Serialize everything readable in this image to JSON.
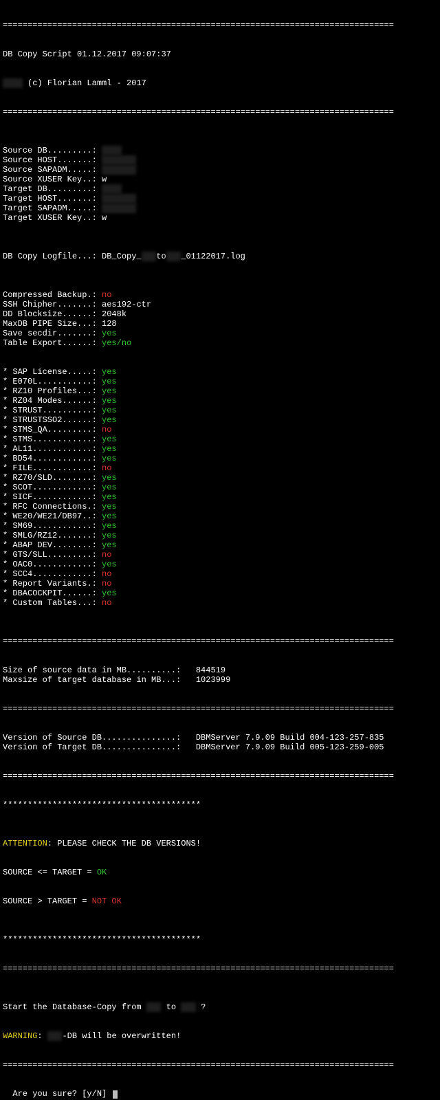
{
  "divider_eq": "===============================================================================",
  "divider_star": "****************************************",
  "header": {
    "title": "DB Copy Script 01.12.2017 09:07:37",
    "copyright": "(c) Florian Lamml - 2017"
  },
  "params": [
    {
      "label": "Source DB.........:",
      "redact": "XXXX"
    },
    {
      "label": "Source HOST.......:",
      "redact": "XXXXXXX"
    },
    {
      "label": "Source SAPADM.....:",
      "redact": "XXXXXXX"
    },
    {
      "label": "Source XUSER Key..:",
      "value": "w"
    },
    {
      "label": "Target DB.........:",
      "redact": "XXXX"
    },
    {
      "label": "Target HOST.......:",
      "redact": "XXXXXXX"
    },
    {
      "label": "Target SAPADM.....:",
      "redact": "XXXXXXX"
    },
    {
      "label": "Target XUSER Key..:",
      "value": "w"
    }
  ],
  "logfile": {
    "label": "DB Copy Logfile...:",
    "pre": "DB_Copy_",
    "r1": "XXX",
    "mid": "to",
    "r2": "XXX",
    "post": "_01122017.log"
  },
  "settings": [
    {
      "label": "Compressed Backup.:",
      "value": "no",
      "cls": "no"
    },
    {
      "label": "SSH Chipher.......:",
      "value": "aes192-ctr",
      "cls": ""
    },
    {
      "label": "DD Blocksize......:",
      "value": "2048k",
      "cls": ""
    },
    {
      "label": "MaxDB PIPE Size...:",
      "value": "128",
      "cls": ""
    },
    {
      "label": "Save secdir.......:",
      "value": "yes",
      "cls": "yes"
    },
    {
      "label": "Table Export......:",
      "value": "yes/no",
      "cls": "yes"
    }
  ],
  "tables": [
    {
      "label": "* SAP License.....:",
      "value": "yes",
      "cls": "yes"
    },
    {
      "label": "* E070L...........:",
      "value": "yes",
      "cls": "yes"
    },
    {
      "label": "* RZ10 Profiles...:",
      "value": "yes",
      "cls": "yes"
    },
    {
      "label": "* RZ04 Modes......:",
      "value": "yes",
      "cls": "yes"
    },
    {
      "label": "* STRUST..........:",
      "value": "yes",
      "cls": "yes"
    },
    {
      "label": "* STRUSTSSO2......:",
      "value": "yes",
      "cls": "yes"
    },
    {
      "label": "* STMS_QA.........:",
      "value": "no",
      "cls": "no"
    },
    {
      "label": "* STMS............:",
      "value": "yes",
      "cls": "yes"
    },
    {
      "label": "* AL11............:",
      "value": "yes",
      "cls": "yes"
    },
    {
      "label": "* BD54............:",
      "value": "yes",
      "cls": "yes"
    },
    {
      "label": "* FILE............:",
      "value": "no",
      "cls": "no"
    },
    {
      "label": "* RZ70/SLD........:",
      "value": "yes",
      "cls": "yes"
    },
    {
      "label": "* SCOT............:",
      "value": "yes",
      "cls": "yes"
    },
    {
      "label": "* SICF............:",
      "value": "yes",
      "cls": "yes"
    },
    {
      "label": "* RFC Connections.:",
      "value": "yes",
      "cls": "yes"
    },
    {
      "label": "* WE20/WE21/DB97..:",
      "value": "yes",
      "cls": "yes"
    },
    {
      "label": "* SM69............:",
      "value": "yes",
      "cls": "yes"
    },
    {
      "label": "* SMLG/RZ12.......:",
      "value": "yes",
      "cls": "yes"
    },
    {
      "label": "* ABAP DEV........:",
      "value": "yes",
      "cls": "yes"
    },
    {
      "label": "* GTS/SLL.........:",
      "value": "no",
      "cls": "no"
    },
    {
      "label": "* OAC0............:",
      "value": "yes",
      "cls": "yes"
    },
    {
      "label": "* SCC4............:",
      "value": "no",
      "cls": "no"
    },
    {
      "label": "* Report Variants.:",
      "value": "no",
      "cls": "no"
    },
    {
      "label": "* DBACOCKPIT......:",
      "value": "yes",
      "cls": "yes"
    },
    {
      "label": "* Custom Tables...:",
      "value": "no",
      "cls": "no"
    }
  ],
  "sizes": [
    {
      "label": "Size of source data in MB..........:",
      "value": "  844519"
    },
    {
      "label": "Maxsize of target database in MB...:",
      "value": "  1023999"
    }
  ],
  "versions": [
    {
      "label": "Version of Source DB...............:",
      "value": "  DBMServer 7.9.09 Build 004-123-257-835"
    },
    {
      "label": "Version of Target DB...............:",
      "value": "  DBMServer 7.9.09 Build 005-123-259-005"
    }
  ],
  "attention": {
    "line": "ATTENTION",
    "tail": ": PLEASE CHECK THE DB VERSIONS!",
    "ok_label": "SOURCE <= TARGET = ",
    "ok_value": "OK",
    "notok_label": "SOURCE > TARGET = ",
    "notok_value": "NOT OK"
  },
  "start": {
    "pre": "Start the Database-Copy from ",
    "mid": " to ",
    "tail": " ?",
    "r1": "XXX",
    "r2": "XXX"
  },
  "warning": {
    "label": "WARNING",
    "pre": ": ",
    "r": "XXX",
    "tail": "-DB will be overwritten!"
  },
  "prompt": "Are you sure? [y/N] "
}
